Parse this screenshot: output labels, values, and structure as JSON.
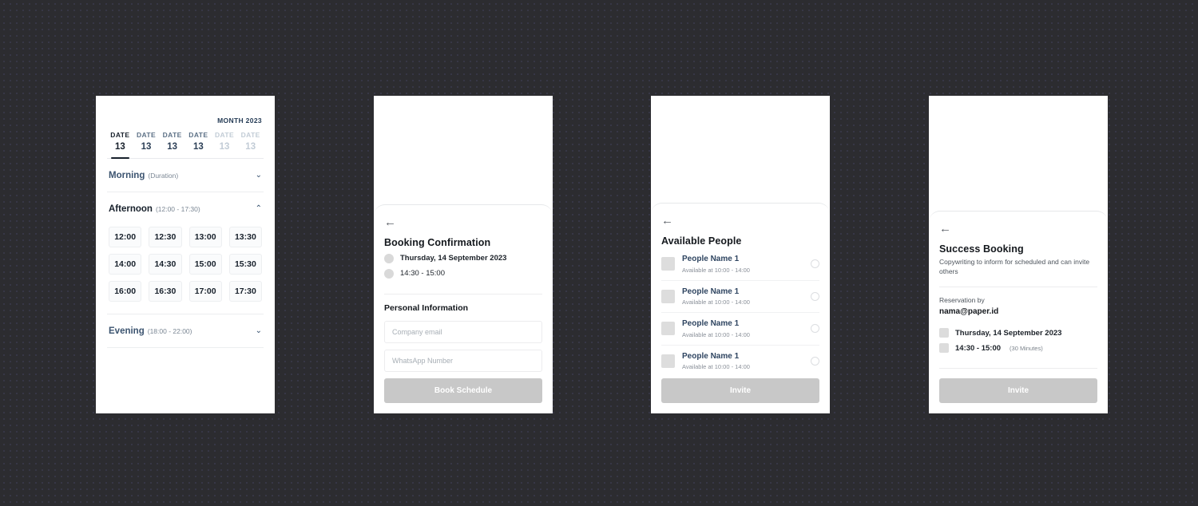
{
  "panel_date": {
    "month_label": "MONTH 2023",
    "dates": [
      {
        "label": "DATE",
        "day": "13",
        "state": "active"
      },
      {
        "label": "DATE",
        "day": "13",
        "state": "enabled"
      },
      {
        "label": "DATE",
        "day": "13",
        "state": "enabled"
      },
      {
        "label": "DATE",
        "day": "13",
        "state": "enabled"
      },
      {
        "label": "DATE",
        "day": "13",
        "state": "disabled"
      },
      {
        "label": "DATE",
        "day": "13",
        "state": "disabled"
      }
    ],
    "sections": [
      {
        "title": "Morning",
        "range": "(Duration)",
        "expanded": false,
        "chevron": "⌄"
      },
      {
        "title": "Afternoon",
        "range": "(12:00 - 17:30)",
        "expanded": true,
        "chevron": "⌃"
      },
      {
        "title": "Evening",
        "range": "(18:00 - 22:00)",
        "expanded": false,
        "chevron": "⌄"
      }
    ],
    "afternoon_slots": [
      "12:00",
      "12:30",
      "13:00",
      "13:30",
      "14:00",
      "14:30",
      "15:00",
      "15:30",
      "16:00",
      "16:30",
      "17:00",
      "17:30"
    ]
  },
  "panel_confirmation": {
    "back_icon": "arrow-left",
    "title": "Booking Confirmation",
    "date_text": "Thursday, 14 September 2023",
    "time_text": "14:30 - 15:00",
    "section_title": "Personal Information",
    "email_placeholder": "Company email",
    "email_value": "",
    "whatsapp_placeholder": "WhatsApp Number",
    "whatsapp_value": "",
    "cta_label": "Book Schedule"
  },
  "panel_people": {
    "back_icon": "arrow-left",
    "title": "Available People",
    "people": [
      {
        "name": "People Name 1",
        "availability": "Available at 10:00 - 14:00",
        "selected": false
      },
      {
        "name": "People Name 1",
        "availability": "Available at 10:00 - 14:00",
        "selected": false
      },
      {
        "name": "People Name 1",
        "availability": "Available at 10:00 - 14:00",
        "selected": false
      },
      {
        "name": "People Name 1",
        "availability": "Available at 10:00 - 14:00",
        "selected": false
      }
    ],
    "cta_label": "Invite"
  },
  "panel_success": {
    "back_icon": "arrow-left",
    "title": "Success Booking",
    "subtitle": "Copywriting to inform for scheduled and can invite others",
    "reservation_label": "Reservation by",
    "reservation_email": "nama@paper.id",
    "date_text": "Thursday, 14 September 2023",
    "time_text": "14:30 - 15:00",
    "time_note": "(30 Minutes)",
    "cta_label": "Invite"
  },
  "theme": {
    "background": "#2c2c30",
    "dot": "#3b3b4d",
    "accent_navy": "#2e4460",
    "cta_disabled": "#c8c8c8",
    "text_dark": "#14181d",
    "text_muted": "#8a9099"
  }
}
